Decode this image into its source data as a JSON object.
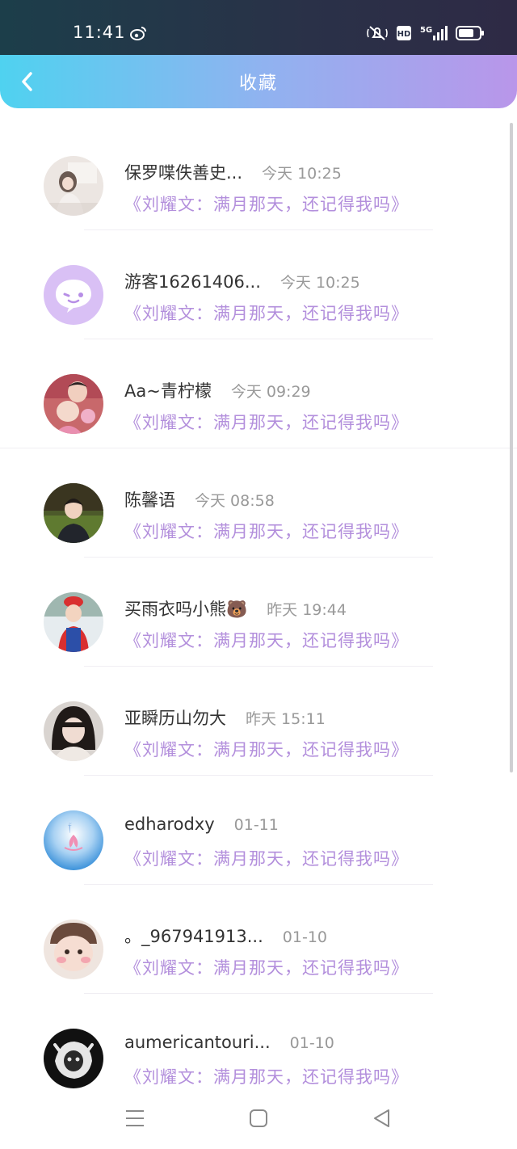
{
  "status_bar": {
    "time": "11:41",
    "icons": [
      "weibo-icon",
      "mute-icon",
      "hd-icon",
      "5g-signal-icon",
      "battery-icon"
    ],
    "hd_label": "HD",
    "network_label": "5G"
  },
  "header": {
    "title": "收藏",
    "back_icon": "chevron-left-icon",
    "gradient": [
      "#4fd2f0",
      "#b996ea"
    ]
  },
  "colors": {
    "accent_link": "#b38fdc",
    "username": "#333333",
    "timestamp": "#999999"
  },
  "favorites": [
    {
      "username": "保罗喋佚善史...",
      "time": "今天 10:25",
      "article": "《刘耀文：满月那天，还记得我吗》"
    },
    {
      "username": "游客16261406...",
      "time": "今天 10:25",
      "article": "《刘耀文：满月那天，还记得我吗》"
    },
    {
      "username": "Aa~青柠檬",
      "time": "今天 09:29",
      "article": "《刘耀文：满月那天，还记得我吗》"
    },
    {
      "username": "陈馨语",
      "time": "今天 08:58",
      "article": "《刘耀文：满月那天，还记得我吗》"
    },
    {
      "username": "买雨衣吗小熊🐻",
      "time": "昨天 19:44",
      "article": "《刘耀文：满月那天，还记得我吗》"
    },
    {
      "username": "亚瞬历山勿大",
      "time": "昨天 15:11",
      "article": "《刘耀文：满月那天，还记得我吗》"
    },
    {
      "username": "edharodxy",
      "time": "01-11",
      "article": "《刘耀文：满月那天，还记得我吗》"
    },
    {
      "username": "。_967941913...",
      "time": "01-10",
      "article": "《刘耀文：满月那天，还记得我吗》"
    },
    {
      "username": "aumericantouri...",
      "time": "01-10",
      "article": "《刘耀文：满月那天，还记得我吗》"
    }
  ],
  "nav_bar": {
    "icons": [
      "menu-icon",
      "home-icon",
      "back-icon"
    ]
  }
}
